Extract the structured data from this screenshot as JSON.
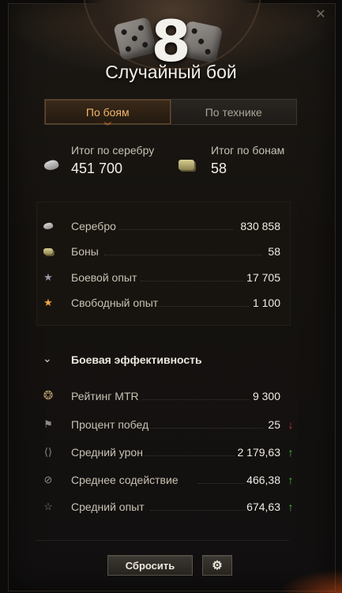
{
  "header": {
    "big_number": "8",
    "battle_title": "Случайный бой",
    "close_icon": "close-icon"
  },
  "tabs": [
    {
      "label": "По боям",
      "active": true
    },
    {
      "label": "По технике",
      "active": false
    }
  ],
  "summary": {
    "silver_label": "Итог по серебру",
    "silver_value": "451 700",
    "bonds_label": "Итог по бонам",
    "bonds_value": "58"
  },
  "totals": [
    {
      "label": "Серебро",
      "value": "830 858",
      "icon": "credits-icon"
    },
    {
      "label": "Боны",
      "value": "58",
      "icon": "bond-icon"
    },
    {
      "label": "Боевой опыт",
      "value": "17 705",
      "icon": "star-icon"
    },
    {
      "label": "Свободный опыт",
      "value": "1 100",
      "icon": "free-xp-star-icon"
    }
  ],
  "efficiency": {
    "title": "Боевая эффективность",
    "rows": [
      {
        "label": "Рейтинг MTR",
        "value": "9 300",
        "icon": "rating-laurel-icon",
        "trend": null
      },
      {
        "label": "Процент побед",
        "value": "25",
        "icon": "flag-icon",
        "trend": "down"
      },
      {
        "label": "Средний урон",
        "value": "2 179,63",
        "icon": "damage-icon",
        "trend": "up"
      },
      {
        "label": "Среднее содействие",
        "value": "466,38",
        "icon": "assist-icon",
        "trend": "up"
      },
      {
        "label": "Средний опыт",
        "value": "674,63",
        "icon": "xp-laurel-icon",
        "trend": "up"
      }
    ]
  },
  "footer": {
    "reset_label": "Сбросить",
    "settings_icon": "gear-icon"
  },
  "colors": {
    "accent": "#f4b56a",
    "up": "#41c23a",
    "down": "#d23a2a"
  }
}
